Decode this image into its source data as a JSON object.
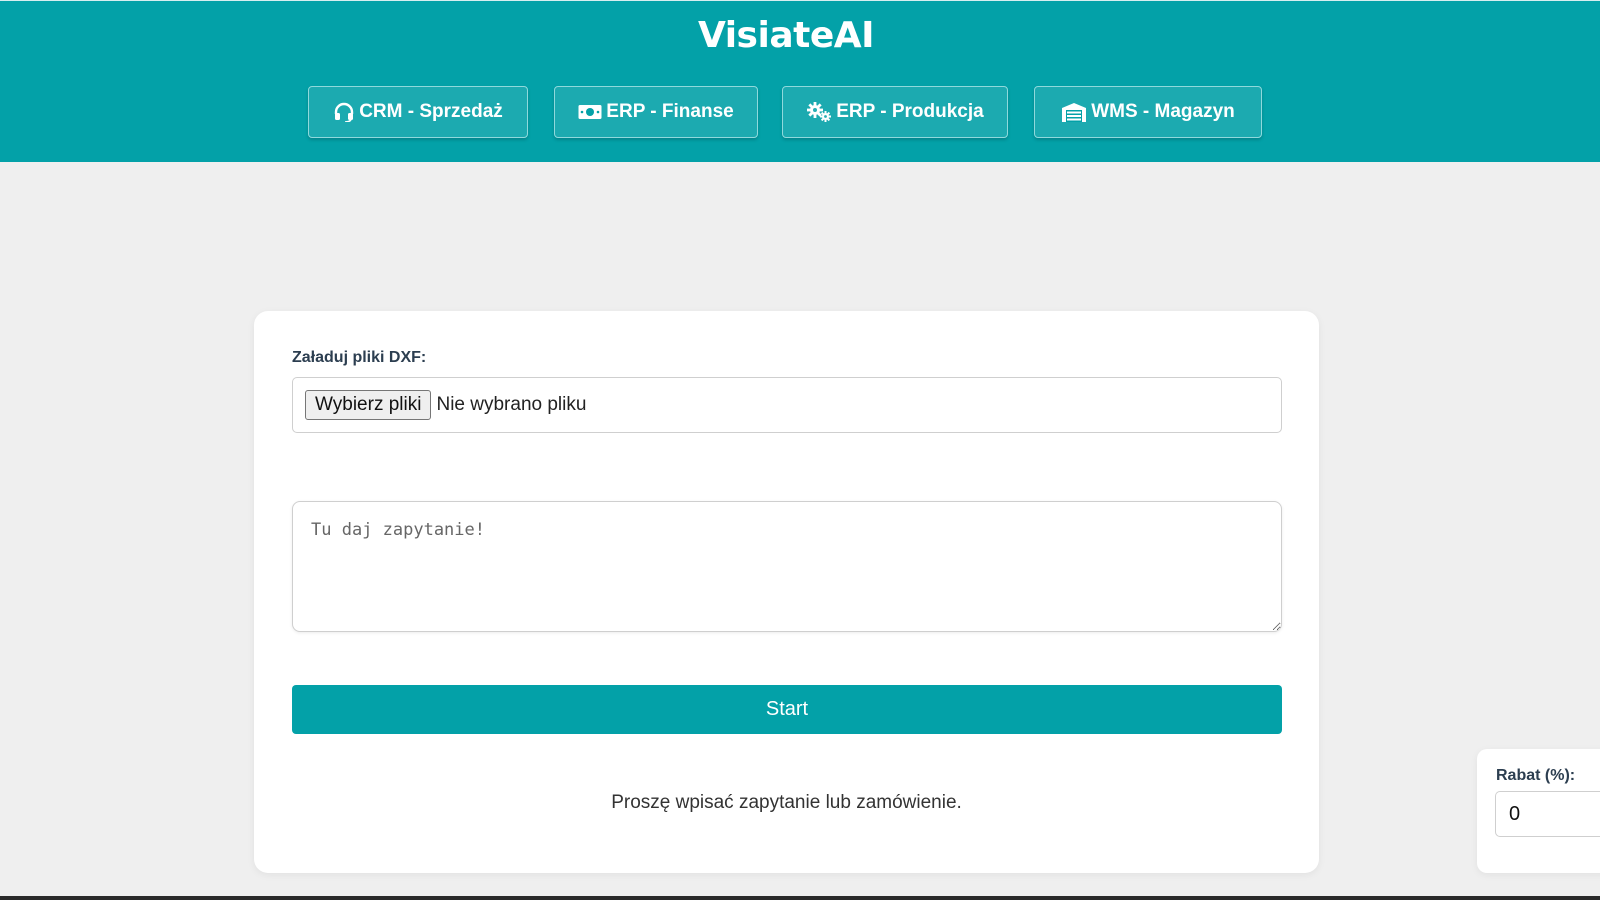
{
  "header": {
    "brand": "VisiateAI",
    "nav": [
      {
        "label": "CRM - Sprzedaż",
        "icon": "headset-icon"
      },
      {
        "label": "ERP - Finanse",
        "icon": "money-bill-icon"
      },
      {
        "label": "ERP - Produkcja",
        "icon": "cogs-icon"
      },
      {
        "label": "WMS - Magazyn",
        "icon": "warehouse-icon"
      }
    ]
  },
  "form": {
    "dxf_label": "Załaduj pliki DXF:",
    "file_button": "Wybierz pliki",
    "file_status": "Nie wybrano pliku",
    "query_placeholder": "Tu daj zapytanie!",
    "start_label": "Start",
    "status_message": "Proszę wpisać zapytanie lub zamówienie."
  },
  "discount": {
    "label": "Rabat (%):",
    "value": "0"
  },
  "colors": {
    "accent": "#03a1a8",
    "background": "#efefef"
  }
}
